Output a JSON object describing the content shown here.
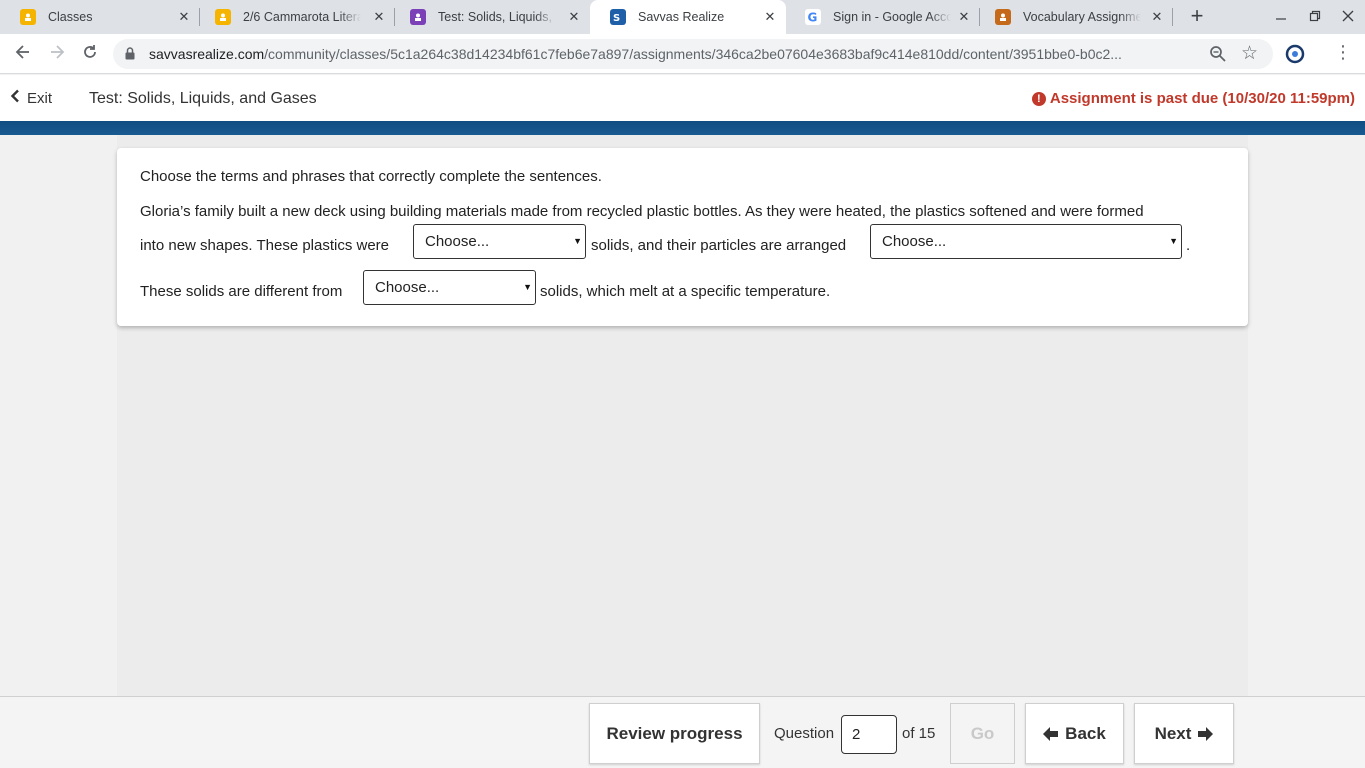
{
  "browser": {
    "tabs": [
      {
        "title": "Classes",
        "icon": "google-classroom-icon",
        "color": "#f4b400",
        "active": false
      },
      {
        "title": "2/6 Cammarota Literacy",
        "icon": "google-classroom-icon",
        "color": "#f4b400",
        "active": false
      },
      {
        "title": "Test: Solids, Liquids, and Gases",
        "icon": "assignment-icon",
        "color": "#7b3fb8",
        "active": false
      },
      {
        "title": "Savvas Realize",
        "icon": "savvas-icon",
        "color": "#1f5fa8",
        "active": true
      },
      {
        "title": "Sign in - Google Accounts",
        "icon": "google-icon",
        "color": "#4285f4",
        "active": false
      },
      {
        "title": "Vocabulary Assignment",
        "icon": "assignment-icon",
        "color": "#c5691b",
        "active": false
      }
    ],
    "close_glyph": "✕",
    "new_tab_glyph": "+",
    "url_host": "savvasrealize.com",
    "url_path": "/community/classes/5c1a264c38d14234bf61c7feb6e7a897/assignments/346ca2be07604e3683baf9c414e810dd/content/3951bbe0-b0c2..."
  },
  "header": {
    "exit_label": "Exit",
    "title": "Test: Solids, Liquids, and Gases",
    "past_due": "Assignment is past due (10/30/20 11:59pm)"
  },
  "question": {
    "instruction": "Choose the terms and phrases that correctly complete the sentences.",
    "line1": "Gloria’s family built a new deck using building materials made from recycled plastic bottles. As they were heated, the plastics softened and were formed",
    "line2_a": "into new shapes. These plastics were",
    "line2_b": "solids, and their particles are arranged",
    "line2_c": ".",
    "line3_a": "These solids are different from",
    "line3_b": "solids, which melt at a specific temperature.",
    "dropdown1": "Choose...",
    "dropdown2": "Choose...",
    "dropdown3": "Choose..."
  },
  "footer": {
    "review_label": "Review progress",
    "question_label": "Question",
    "question_number": "2",
    "of_label": "of 15",
    "go_label": "Go",
    "back_label": "Back",
    "next_label": "Next"
  }
}
